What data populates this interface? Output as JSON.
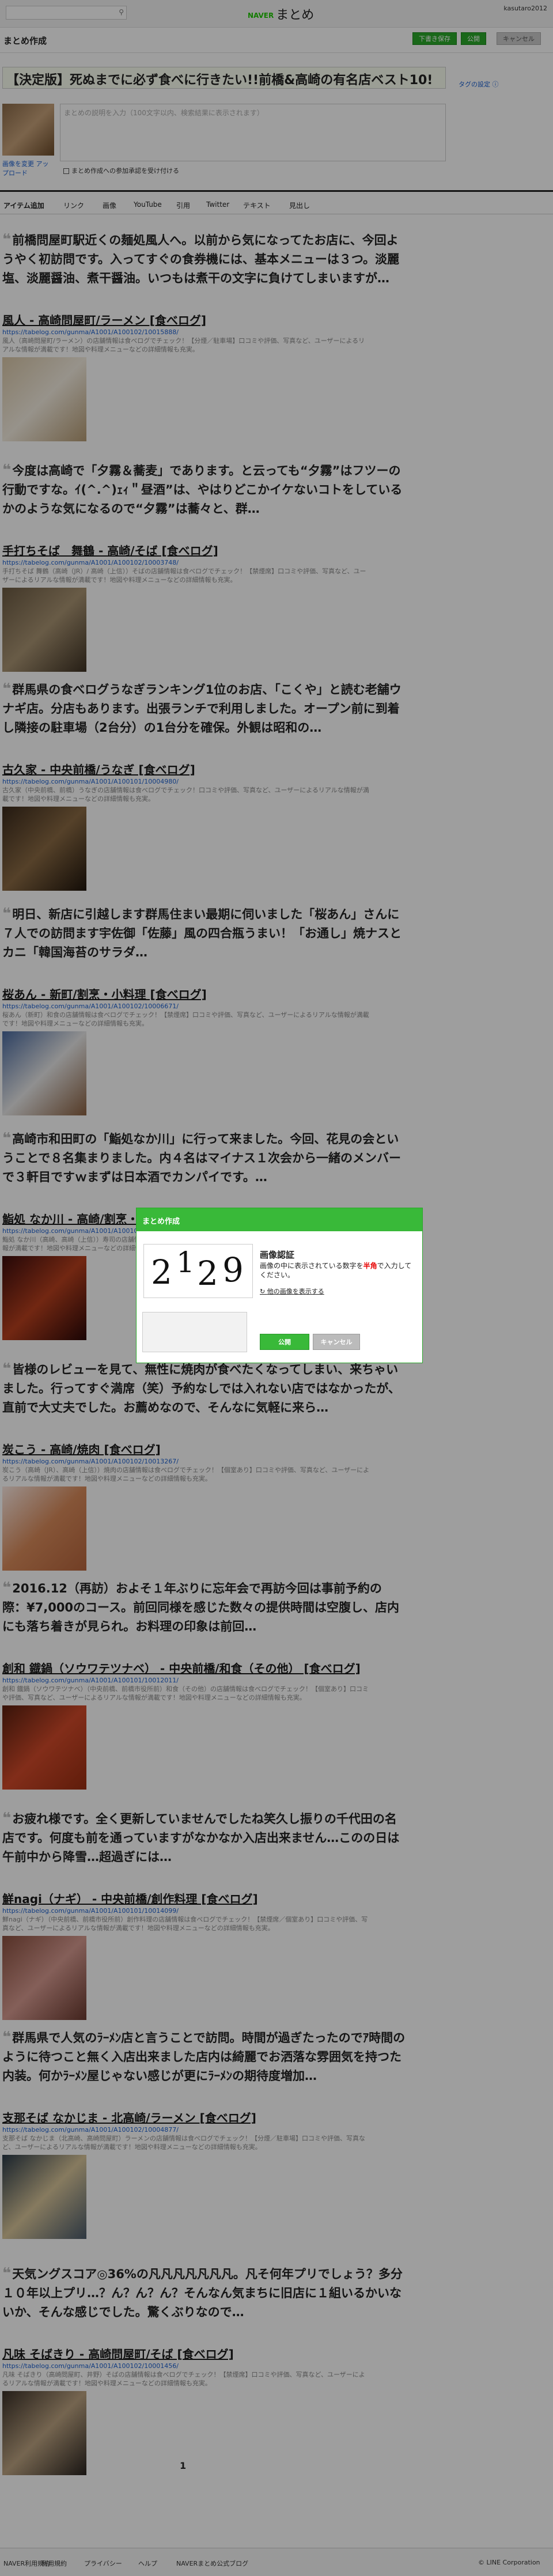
{
  "header": {
    "search_icon": "magnifier-icon",
    "brand_naver": "NAVER",
    "brand_matome": "まとめ",
    "user_name": "kasutaro2012"
  },
  "subheader": {
    "title": "まとめ作成",
    "btn_draft": "下書き保存",
    "btn_publish": "公開",
    "btn_cancel": "キャンセル"
  },
  "editor": {
    "title": "【決定版】死ぬまでに必ず食べに行きたい!!前橋&高崎の有名店ベスト10!",
    "title_hint": "タグの設定 ⓘ",
    "desc_placeholder": "まとめの説明を入力（100文字以内、検索結果に表示されます）",
    "change_image": "画像を変更 アップロード",
    "checkbox_label": "まとめ作成への参加承認を受け付ける"
  },
  "tabs": [
    "アイテム追加",
    "リンク",
    "画像",
    "YouTube",
    "引用",
    "Twitter",
    "テキスト",
    "見出し"
  ],
  "items": [
    {
      "quote": "前橋問屋町駅近くの麺処風人へ。以前から気になってたお店に、今回ようやく初訪問です。入ってすぐの食券機には、基本メニューは３つ。淡麗塩、淡麗醤油、煮干醤油。いつもは煮干の文字に負けてしまいますが…",
      "title": "風人 - 高崎問屋町/ラーメン [食べログ]",
      "url": "https://tabelog.com/gunma/A1001/A100102/10015888/",
      "desc": "風人（高崎問屋町/ラーメン）の店舗情報は食べログでチェック！【分煙／駐車場】口コミや評価、写真など、ユーザーによるリアルな情報が満載です！地図や料理メニューなどの詳細情報も充実。"
    },
    {
      "quote": "今度は高崎で「夕霧＆蕎麦」であります。と云っても“夕霧”はフツーの行動ですな。ｲ(^.^)ｪｨ＂昼酒”は、やはりどこかイケないコトをしているかのような気になるので“夕霧”は蕎々と、群…",
      "title": "手打ちそば　舞鶴 - 高崎/そば [食べログ]",
      "url": "https://tabelog.com/gunma/A1001/A100102/10003748/",
      "desc": "手打ちそば 舞鶴（高崎（JR）/ 高崎（上信））そばの店舗情報は食べログでチェック！【禁煙席】口コミや評価、写真など、ユーザーによるリアルな情報が満載です！地図や料理メニューなどの詳細情報も充実。"
    },
    {
      "quote": "群馬県の食べログうなぎランキング1位のお店、「こくや」と読む老舗ウナギ店。分店もあります。出張ランチで利用しました。オープン前に到着し隣接の駐車場（2台分）の1台分を確保。外観は昭和の…",
      "title": "古久家 - 中央前橋/うなぎ [食べログ]",
      "url": "https://tabelog.com/gunma/A1001/A100101/10004980/",
      "desc": "古久家（中央前橋、前橋）うなぎの店舗情報は食べログでチェック！口コミや評価、写真など、ユーザーによるリアルな情報が満載です！地図や料理メニューなどの詳細情報も充実。"
    },
    {
      "quote": "明日、新店に引越します群馬住まい最期に伺いました「桜あん」さんに７人での訪問ます宇佐御「佐藤」風の四合瓶うまい！「お通し」焼ナスとカニ「韓国海苔のサラダ…",
      "title": "桜あん - 新町/割烹・小料理 [食べログ]",
      "url": "https://tabelog.com/gunma/A1001/A100102/10006671/",
      "desc": "桜あん（新町）和食の店舗情報は食べログでチェック！【禁煙席】口コミや評価、写真など、ユーザーによるリアルな情報が満載です！地図や料理メニューなどの詳細情報も充実。"
    },
    {
      "quote": "高崎市和田町の「鮨処なか川」に行って来ました。今回、花見の会ということで８名集まりました。内４名はマイナス１次会から一緒のメンバーで３軒目ですｗまずは日本酒でカンパイです。…",
      "title": "鮨処 なか川 - 高崎/割烹・小料理 [食べログ]",
      "url": "https://tabelog.com/gunma/A1001/A100102/10009812/",
      "desc": "鮨処 なか川（高崎、高崎（上信））寿司の店舗情報は食べログでチェック！口コミや評価、写真など、ユーザーによるリアルな情報が満載です！地図や料理メニューなどの詳細情報も充実。"
    },
    {
      "quote": "皆様のレビューを見て、無性に焼肉が食べたくなってしまい、来ちゃいました。行ってすぐ満席（笑）予約なしでは入れない店ではなかったが、直前で大丈夫でした。お薦めなので、そんなに気軽に来ら…",
      "title": "炭こう - 高崎/焼肉 [食べログ]",
      "url": "https://tabelog.com/gunma/A1001/A100102/10013267/",
      "desc": "炭こう（高崎（JR）、高崎（上信））焼肉の店舗情報は食べログでチェック！【個室あり】口コミや評価、写真など、ユーザーによるリアルな情報が満載です！地図や料理メニューなどの詳細情報も充実。"
    },
    {
      "quote": "2016.12（再訪）およそ１年ぶりに忘年会で再訪今回は事前予約の際：¥7,000のコース。前回同様を感じた数々の提供時間は空腹し、店内にも落ち着きが見られ。お料理の印象は前回…",
      "title": "創和 鐡鍋（ソウワテツナベ） - 中央前橋/和食（その他） [食べログ]",
      "url": "https://tabelog.com/gunma/A1001/A100101/10012011/",
      "desc": "創和 鐡鍋（ソウワテツナベ）（中央前橋、前橋市役所前）和食（その他）の店舗情報は食べログでチェック！【個室あり】口コミや評価、写真など、ユーザーによるリアルな情報が満載です！地図や料理メニューなどの詳細情報も充実。"
    },
    {
      "quote": "お疲れ様です。全く更新していませんでしたね笑久し振りの千代田の名店です。何度も前を通っていますがなかなか入店出来ません…このの日は午前中から降雪…超過ぎには…",
      "title": "鮮nagi（ナギ） - 中央前橋/創作料理 [食べログ]",
      "url": "https://tabelog.com/gunma/A1001/A100101/10014099/",
      "desc": "鮮nagi（ナギ）（中央前橋、前橋市役所前）創作料理の店舗情報は食べログでチェック！【禁煙席／個室あり】口コミや評価、写真など、ユーザーによるリアルな情報が満載です！地図や料理メニューなどの詳細情報も充実。"
    },
    {
      "quote": "群馬県で人気のﾗｰﾒﾝ店と言うことで訪問。時間が過ぎたったのでｱ時間のように待つこと無く入店出来ました店内は綺麗でお洒落な雰囲気を持つた内装。何かﾗｰﾒﾝ屋じゃない感じが更にﾗｰﾒﾝの期待度増加…",
      "title": "支那そば なかじま - 北高崎/ラーメン [食べログ]",
      "url": "https://tabelog.com/gunma/A1001/A100102/10004877/",
      "desc": "支那そば なかじま（北高崎、高崎問屋町）ラーメンの店舗情報は食べログでチェック！【分煙／駐車場】口コミや評価、写真など、ユーザーによるリアルな情報が満載です！地図や料理メニューなどの詳細情報も充実。"
    },
    {
      "quote": "天気ングスコア◎36%の凡凡凡凡凡凡凡。凡そ何年プリでしょう？多分１０年以上プリ…？ん？ん？ん？そんなん気まちに旧店に１組いるかいないか、そんな感じでした。驚くぶりなので…",
      "title": "凡味 そばきり - 高崎問屋町/そば [食べログ]",
      "url": "https://tabelog.com/gunma/A1001/A100102/10001456/",
      "desc": "凡味 そばきり（高崎問屋町、井野）そばの店舗情報は食べログでチェック！【禁煙席】口コミや評価、写真など、ユーザーによるリアルな情報が満載です！地図や料理メニューなどの詳細情報も充実。"
    }
  ],
  "pagination": {
    "current": "1"
  },
  "footer": [
    "NAVER利用規約",
    "利用規約",
    "プライバシー",
    "ヘルプ",
    "NAVERまとめ公式ブログ",
    "© LINE Corporation"
  ],
  "modal": {
    "header": "まとめ作成",
    "captcha_digits": [
      "2",
      "1",
      "2",
      "9"
    ],
    "label": "画像認証",
    "instruction_pre": "画像の中に表示されている数字を",
    "instruction_red": "半角",
    "instruction_post": "で入力してください。",
    "other_image": "他の画像を表示する",
    "ok": "公開",
    "cancel": "キャンセル"
  },
  "colors": {
    "accent": "#39b939",
    "link": "#1a5fd0",
    "red": "#e60000"
  }
}
